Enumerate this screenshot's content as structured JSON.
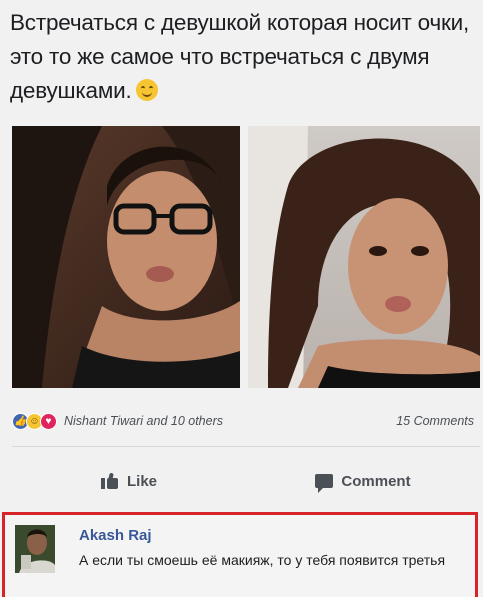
{
  "post": {
    "text": "Встречаться с девушкой которая носит очки, это то же самое что встречаться с двумя девушками."
  },
  "reactions": {
    "names": "Nishant Tiwari and 10 others",
    "comments_count": "15 Comments"
  },
  "actions": {
    "like_label": "Like",
    "comment_label": "Comment"
  },
  "comment": {
    "author": "Akash Raj",
    "text": "А если ты смоешь её макияж, то у тебя появится третья"
  },
  "colors": {
    "like_blue": "#4267b2",
    "love_red": "#e0245e",
    "haha_yellow": "#f7c531",
    "highlight_border": "#d6242a",
    "author_link": "#385898"
  }
}
